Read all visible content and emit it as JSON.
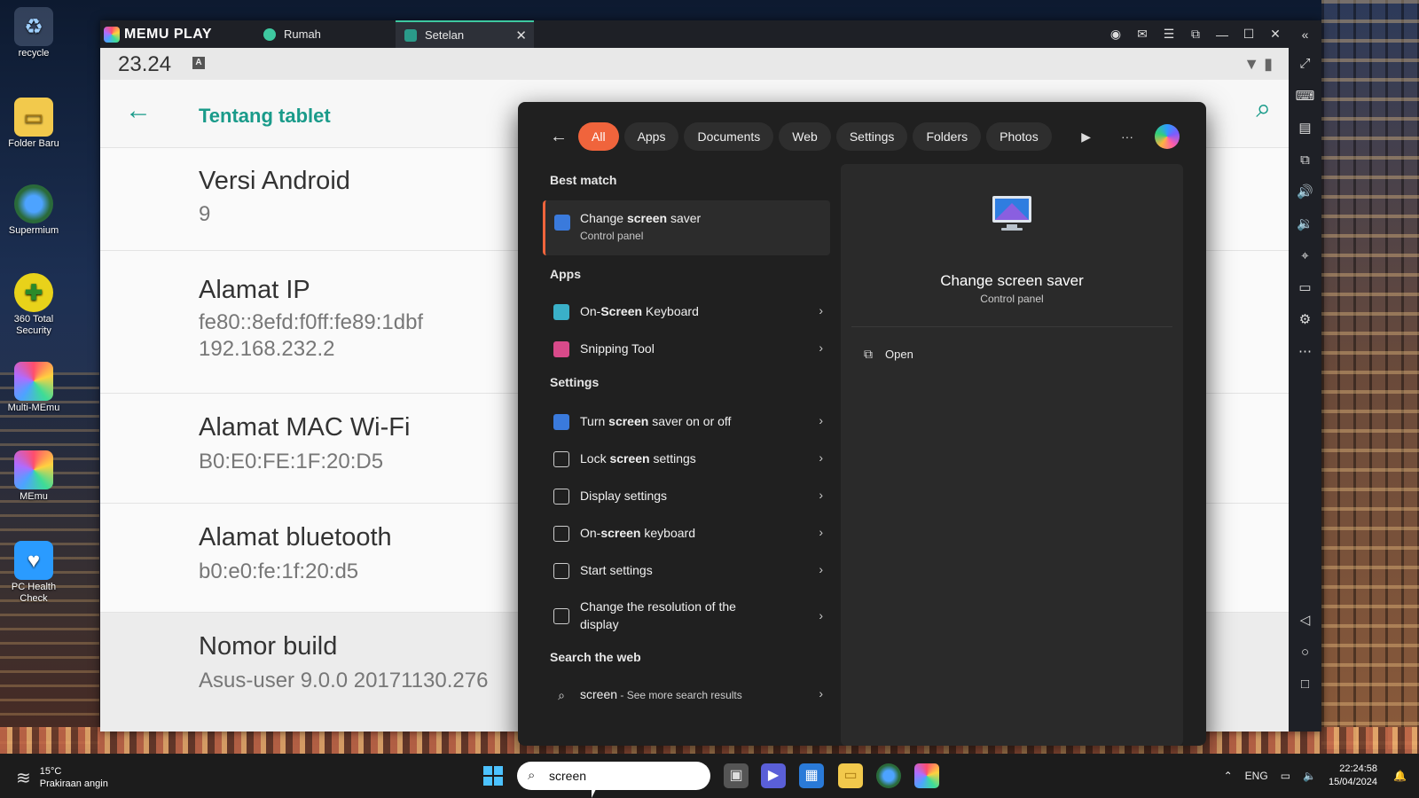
{
  "desktop": {
    "icons": [
      {
        "label": "recycle",
        "icon": "recycle-bin-icon"
      },
      {
        "label": "Folder Baru",
        "icon": "folder-icon"
      },
      {
        "label": "Supermium",
        "icon": "browser-icon"
      },
      {
        "label": "360 Total Security",
        "icon": "shield-plus-icon"
      },
      {
        "label": "Multi-MEmu",
        "icon": "memu-multi-icon"
      },
      {
        "label": "MEmu",
        "icon": "memu-icon"
      },
      {
        "label": "PC Health Check",
        "icon": "health-icon"
      }
    ]
  },
  "memu": {
    "brand": "MEMU PLAY",
    "tabs": [
      {
        "label": "Rumah",
        "active": false
      },
      {
        "label": "Setelan",
        "active": true
      }
    ]
  },
  "android": {
    "status_time": "23.24",
    "status_badge": "A",
    "header_title": "Tentang tablet",
    "rows": [
      {
        "title": "Versi Android",
        "value": "9"
      },
      {
        "title": "Alamat IP",
        "value": "fe80::8efd:f0ff:fe89:1dbf\n192.168.232.2"
      },
      {
        "title": "Alamat MAC Wi-Fi",
        "value": "B0:E0:FE:1F:20:D5"
      },
      {
        "title": "Alamat bluetooth",
        "value": "b0:e0:fe:1f:20:d5"
      },
      {
        "title": "Nomor build",
        "value": "Asus-user 9.0.0 20171130.276"
      }
    ]
  },
  "search_panel": {
    "filters": [
      "All",
      "Apps",
      "Documents",
      "Web",
      "Settings",
      "Folders",
      "Photos"
    ],
    "more": "···",
    "best_match_label": "Best match",
    "best_match": {
      "pre": "Change ",
      "bold": "screen",
      "post": " saver",
      "sub": "Control panel"
    },
    "apps_label": "Apps",
    "apps": [
      {
        "pre": "On-",
        "bold": "Screen",
        "post": " Keyboard"
      },
      {
        "pre": "Snipping Tool",
        "bold": "",
        "post": ""
      }
    ],
    "settings_label": "Settings",
    "settings": [
      {
        "pre": "Turn ",
        "bold": "screen",
        "post": " saver on or off"
      },
      {
        "pre": "Lock ",
        "bold": "screen",
        "post": " settings"
      },
      {
        "pre": "Display settings",
        "bold": "",
        "post": ""
      },
      {
        "pre": "On-",
        "bold": "screen",
        "post": " keyboard"
      },
      {
        "pre": "Start settings",
        "bold": "",
        "post": ""
      },
      {
        "pre": "Change the resolution of the",
        "bold": "",
        "post": "",
        "line2": "display"
      }
    ],
    "web_label": "Search the web",
    "web": {
      "query": "screen",
      "suffix": " - See more search results"
    },
    "preview": {
      "title": "Change screen saver",
      "sub": "Control panel",
      "action": "Open"
    }
  },
  "taskbar": {
    "weather_temp": "15°C",
    "weather_desc": "Prakiraan angin",
    "search_value": "screen",
    "lang": "ENG",
    "time": "22:24:58",
    "date": "15/04/2024"
  }
}
